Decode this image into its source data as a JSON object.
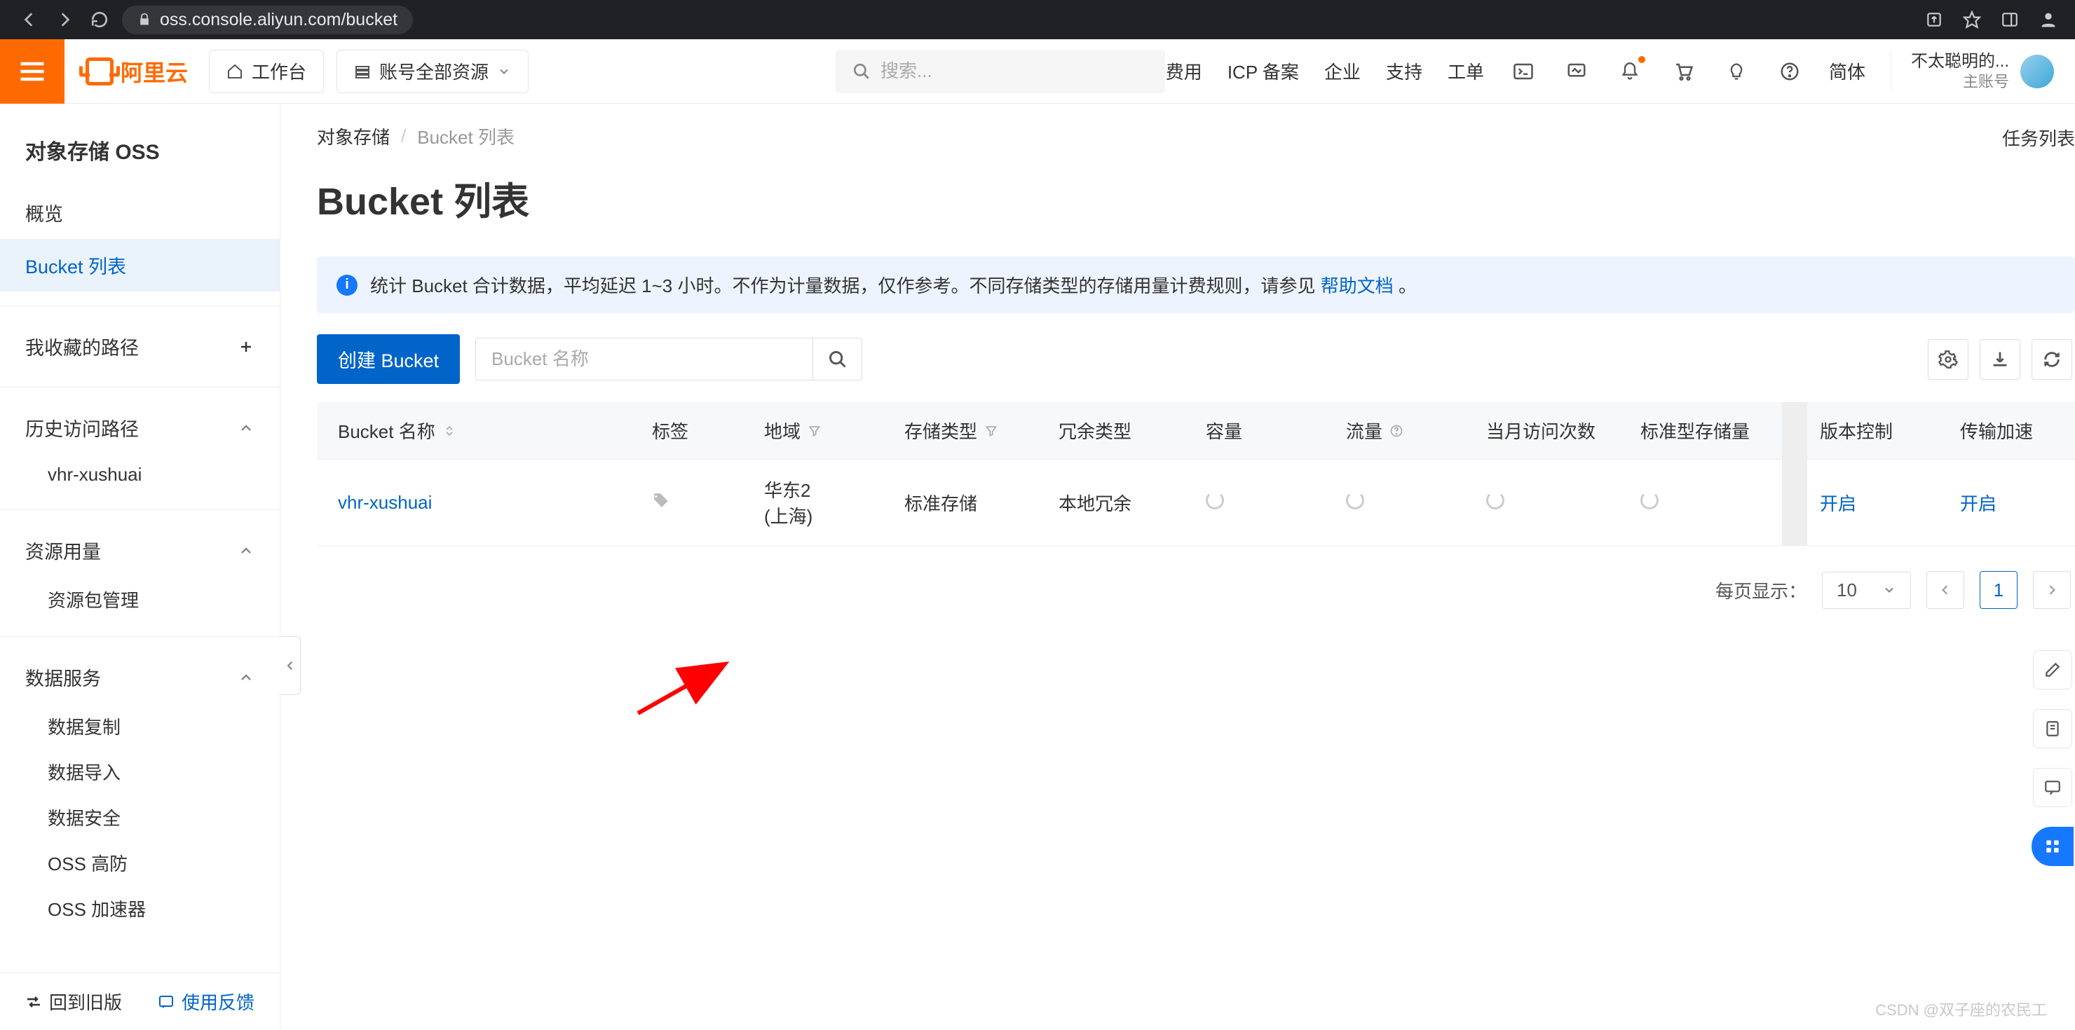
{
  "browser": {
    "url": "oss.console.aliyun.com/bucket"
  },
  "topbar": {
    "logo_text": "阿里云",
    "workbench": "工作台",
    "account_scope": "账号全部资源",
    "search_placeholder": "搜索...",
    "links": {
      "cost": "费用",
      "icp": "ICP 备案",
      "enterprise": "企业",
      "support": "支持",
      "ticket": "工单",
      "lang": "简体"
    },
    "user": {
      "name": "不太聪明的...",
      "sub": "主账号"
    }
  },
  "sidebar": {
    "title": "对象存储 OSS",
    "overview": "概览",
    "bucket_list": "Bucket 列表",
    "favorites": "我收藏的路径",
    "history_title": "历史访问路径",
    "history_items": [
      "vhr-xushuai"
    ],
    "usage_title": "资源用量",
    "usage_items": [
      "资源包管理"
    ],
    "data_title": "数据服务",
    "data_items": [
      "数据复制",
      "数据导入",
      "数据安全",
      "OSS 高防",
      "OSS 加速器"
    ],
    "footer": {
      "back": "回到旧版",
      "feedback": "使用反馈"
    }
  },
  "main": {
    "crumb_root": "对象存储",
    "crumb_current": "Bucket 列表",
    "task_list": "任务列表",
    "title": "Bucket 列表",
    "alert_text": "统计 Bucket 合计数据，平均延迟 1~3 小时。不作为计量数据，仅作参考。不同存储类型的存储用量计费规则，请参见",
    "alert_link": "帮助文档",
    "alert_tail": "。",
    "create_btn": "创建 Bucket",
    "search_placeholder": "Bucket 名称",
    "columns": {
      "name": "Bucket 名称",
      "tag": "标签",
      "region": "地域",
      "storage": "存储类型",
      "redundancy": "冗余类型",
      "capacity": "容量",
      "traffic": "流量",
      "visits": "当月访问次数",
      "std_storage": "标准型存储量",
      "version": "版本控制",
      "accel": "传输加速"
    },
    "row": {
      "name": "vhr-xushuai",
      "region_l1": "华东2",
      "region_l2": "(上海)",
      "storage": "标准存储",
      "redundancy": "本地冗余",
      "version": "开启",
      "accel": "开启"
    },
    "pager": {
      "label": "每页显示：",
      "size": "10",
      "page": "1"
    }
  },
  "watermark": "CSDN @双子座的农民工"
}
